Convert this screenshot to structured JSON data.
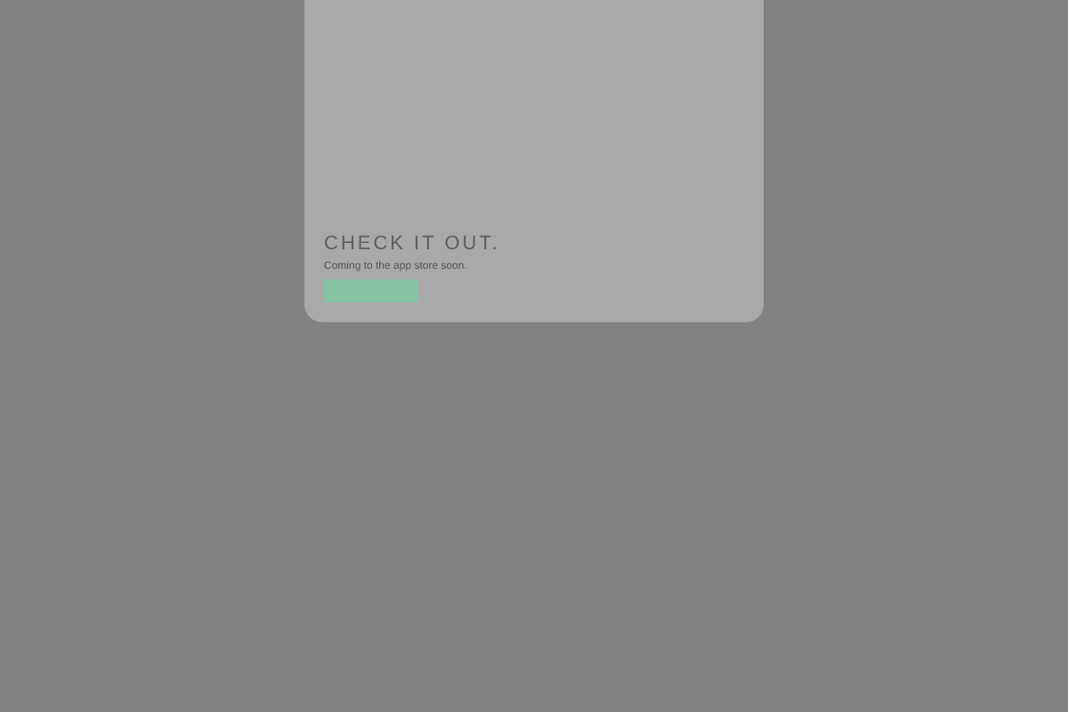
{
  "card": {
    "heading": "CHECK IT OUT.",
    "subtitle": "Coming to the app store soon."
  }
}
